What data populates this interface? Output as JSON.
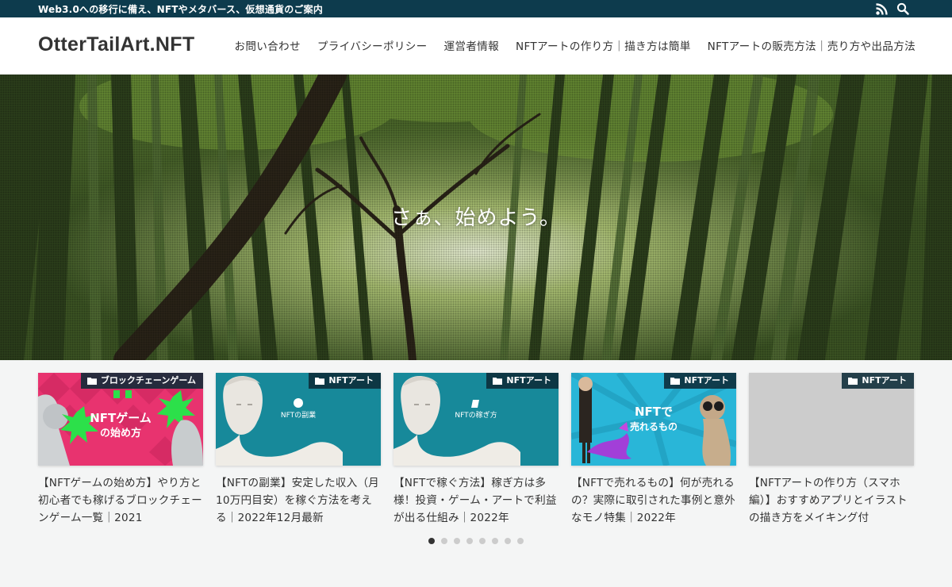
{
  "topbar": {
    "tagline": "Web3.0への移行に備え、NFTやメタバース、仮想通貨のご案内",
    "icons": [
      "rss-icon",
      "search-icon"
    ]
  },
  "header": {
    "site_title": "OtterTailArt.NFT",
    "nav": [
      "お問い合わせ",
      "プライバシーポリシー",
      "運営者情報",
      "NFTアートの作り方｜描き方は簡単",
      "NFTアートの販売方法｜売り方や出品方法"
    ]
  },
  "hero": {
    "text": "さぁ、始めよう。"
  },
  "cards": [
    {
      "category": "ブロックチェーンゲーム",
      "title": "【NFTゲームの始め方】やり方と初心者でも稼げるブロックチェーンゲーム一覧｜2021",
      "thumb_text": [
        "NFTゲーム",
        "の始め方"
      ]
    },
    {
      "category": "NFTアート",
      "title": "【NFTの副業】安定した収入（月10万円目安）を稼ぐ方法を考える｜2022年12月最新",
      "thumb_text": [
        "NFTの副業"
      ]
    },
    {
      "category": "NFTアート",
      "title": "【NFTで稼ぐ方法】稼ぎ方は多様！投資・ゲーム・アートで利益が出る仕組み｜2022年",
      "thumb_text": [
        "NFTの稼ぎ方"
      ]
    },
    {
      "category": "NFTアート",
      "title": "【NFTで売れるもの】何が売れるの？実際に取引された事例と意外なモノ特集｜2022年",
      "thumb_text": [
        "NFTで",
        "売れるもの"
      ]
    },
    {
      "category": "NFTアート",
      "title": "【NFTアートの作り方（スマホ編）】おすすめアプリとイラストの描き方をメイキング付",
      "thumb_text": []
    }
  ],
  "pager": {
    "count": 8,
    "active": 0
  },
  "colors": {
    "topbar": "#0d3b4d",
    "category_badge": "#0d2b38",
    "teal_thumb": "#17899a",
    "pink_thumb": "#e8336f",
    "cyan_thumb": "#29b6d8"
  }
}
